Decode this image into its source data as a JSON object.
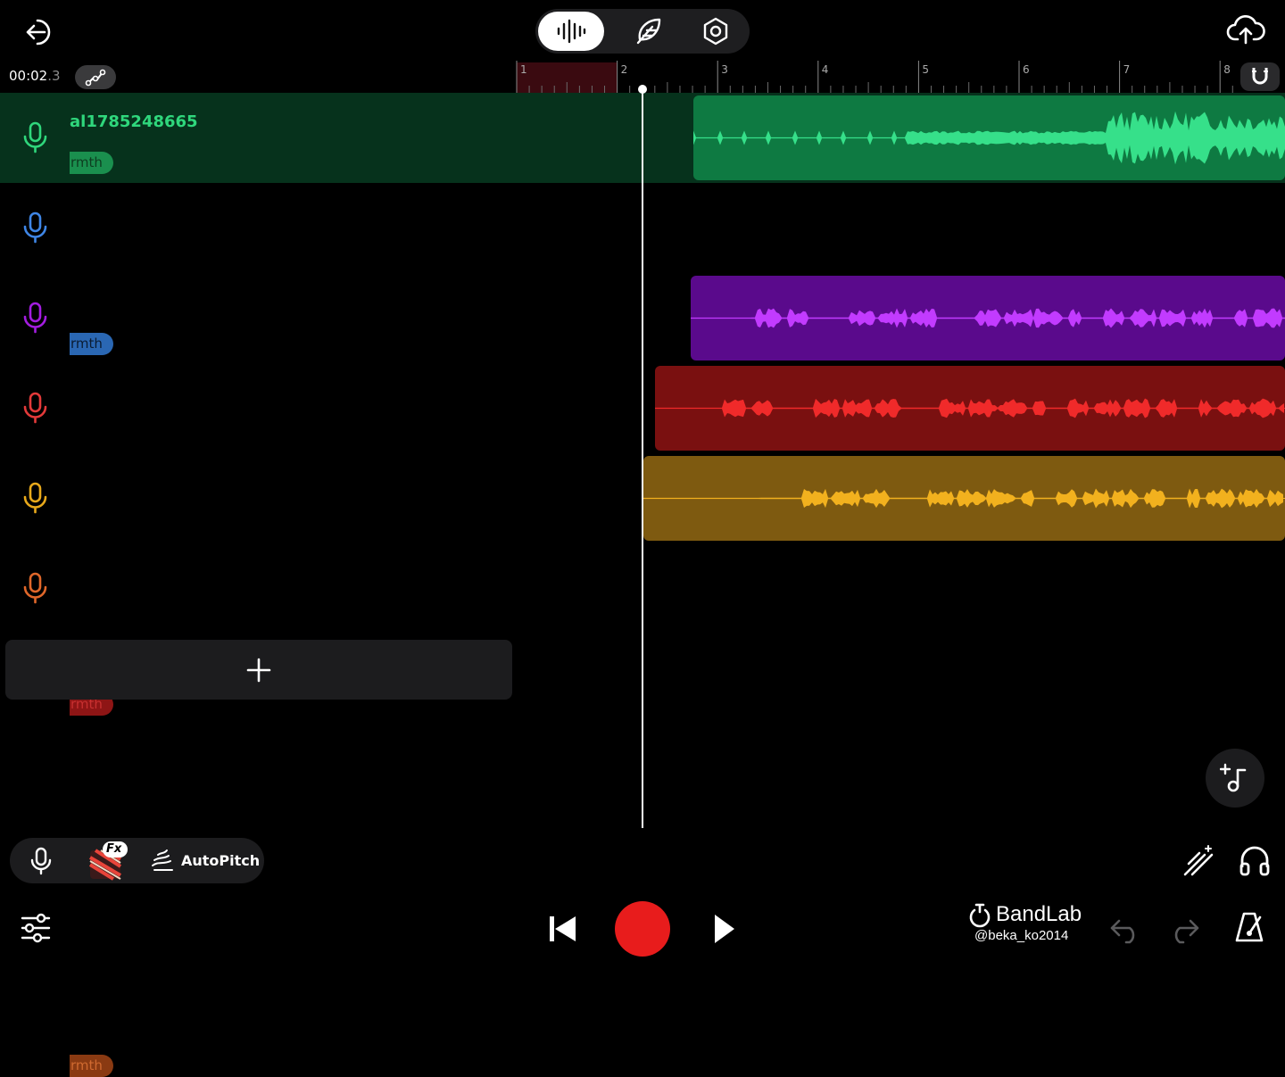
{
  "transport": {
    "time_main": "00:02",
    "time_sub": ".3"
  },
  "timeline": {
    "bar_numbers": [
      "1",
      "2",
      "3",
      "4",
      "5",
      "6",
      "7",
      "8"
    ],
    "loop_region_color": "#3a0a10"
  },
  "tracks": [
    {
      "name": "al1785248665",
      "preset": "rmth",
      "color": "#2fd77c",
      "pill_bg": "#1a8f4e",
      "pill_text": "#0d3d20",
      "selected": true
    },
    {
      "name": "",
      "preset": "rmth",
      "color": "#3f86e6",
      "pill_bg": "#2a67b3",
      "pill_text": "#0a1c33"
    },
    {
      "name": "",
      "preset": "",
      "color": "#a31de0",
      "pill_bg": "",
      "pill_text": ""
    },
    {
      "name": "",
      "preset": "rmth",
      "color": "#e33a3a",
      "pill_bg": "#8e1515",
      "pill_text": "#c83030"
    },
    {
      "name": "",
      "preset": "",
      "color": "#e8a91b",
      "pill_bg": "",
      "pill_text": ""
    },
    {
      "name": "",
      "preset": "rmth",
      "color": "#e0672a",
      "pill_bg": "#8a3a12",
      "pill_text": "#d06a30"
    }
  ],
  "regions": [
    {
      "track": 0,
      "bg": "#0e7a42",
      "wave": "#36e08a"
    },
    {
      "track": 2,
      "bg": "#5a0a8c",
      "wave": "#c23bff"
    },
    {
      "track": 3,
      "bg": "#7a1010",
      "wave": "#f02a2a"
    },
    {
      "track": 4,
      "bg": "#7e5a10",
      "wave": "#f2b11e"
    }
  ],
  "toolbar": {
    "autopitch_label": "AutoPitch",
    "fx_badge": "Fx"
  },
  "brand": {
    "name": "BandLab",
    "user": "@beka_ko2014"
  },
  "icons": {
    "exit": "exit-icon",
    "waveform_tab": "waveform-icon",
    "fx_tab": "feather-icon",
    "settings_tab": "hex-settings-icon",
    "upload": "cloud-upload-icon",
    "automation": "automation-icon",
    "snap": "magnet-icon",
    "add_instrument": "add-music-note-icon",
    "magic": "magic-wand-icon",
    "monitor": "headphones-icon",
    "mixer": "sliders-icon",
    "rewind": "skip-back-icon",
    "record": "record-icon",
    "play": "play-icon",
    "undo": "undo-icon",
    "redo": "redo-icon",
    "metronome": "metronome-icon"
  }
}
